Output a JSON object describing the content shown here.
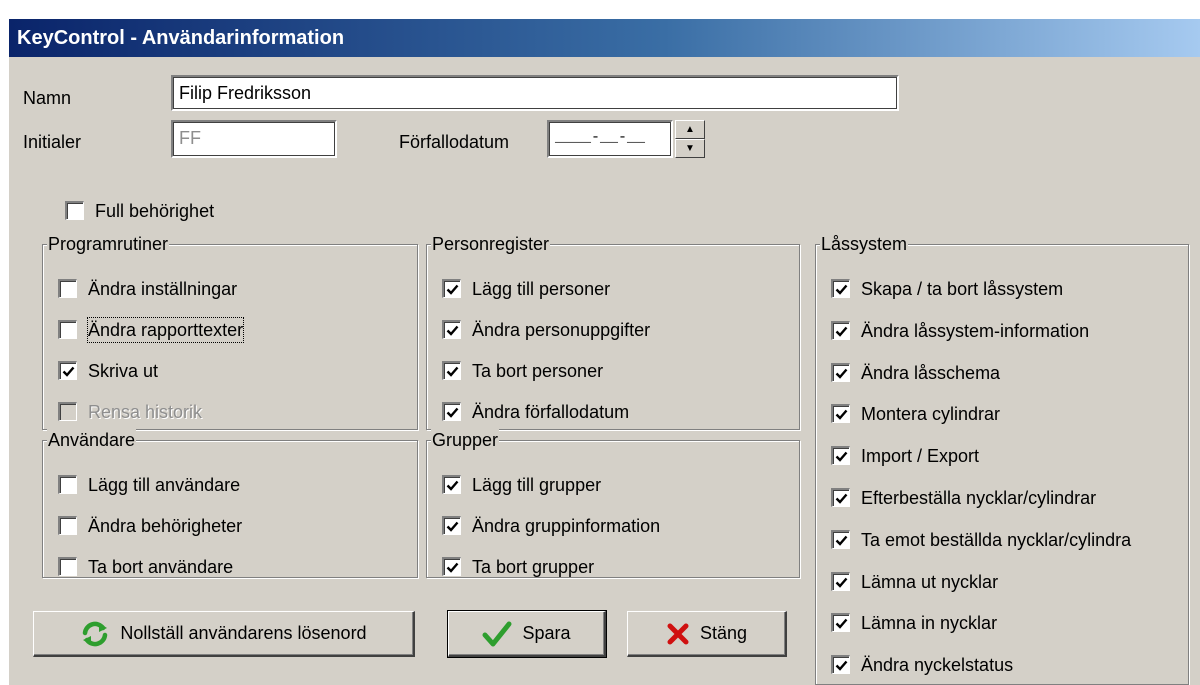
{
  "window": {
    "title": "KeyControl - Användarinformation"
  },
  "form": {
    "name_label": "Namn",
    "name_value": "Filip Fredriksson",
    "initials_label": "Initialer",
    "initials_value": "FF",
    "expiry_label": "Förfallodatum",
    "expiry_value": "____-__-__"
  },
  "full_access": {
    "label": "Full behörighet",
    "checked": false
  },
  "groups": {
    "programrutiner": {
      "title": "Programrutiner",
      "items": [
        {
          "label": "Ändra inställningar",
          "checked": false,
          "enabled": true
        },
        {
          "label": "Ändra rapporttexter",
          "checked": false,
          "enabled": true,
          "focused": true
        },
        {
          "label": "Skriva ut",
          "checked": true,
          "enabled": true
        },
        {
          "label": "Rensa historik",
          "checked": false,
          "enabled": false
        }
      ]
    },
    "anvandare": {
      "title": "Användare",
      "items": [
        {
          "label": "Lägg till användare",
          "checked": false,
          "enabled": true
        },
        {
          "label": "Ändra behörigheter",
          "checked": false,
          "enabled": true
        },
        {
          "label": "Ta bort användare",
          "checked": false,
          "enabled": true
        }
      ]
    },
    "personregister": {
      "title": "Personregister",
      "items": [
        {
          "label": "Lägg till personer",
          "checked": true,
          "enabled": true
        },
        {
          "label": "Ändra personuppgifter",
          "checked": true,
          "enabled": true
        },
        {
          "label": "Ta bort personer",
          "checked": true,
          "enabled": true
        },
        {
          "label": "Ändra förfallodatum",
          "checked": true,
          "enabled": true
        }
      ]
    },
    "grupper": {
      "title": "Grupper",
      "items": [
        {
          "label": "Lägg till grupper",
          "checked": true,
          "enabled": true
        },
        {
          "label": "Ändra gruppinformation",
          "checked": true,
          "enabled": true
        },
        {
          "label": "Ta bort grupper",
          "checked": true,
          "enabled": true
        }
      ]
    },
    "lassystem": {
      "title": "Låssystem",
      "items": [
        {
          "label": "Skapa / ta bort låssystem",
          "checked": true,
          "enabled": true
        },
        {
          "label": "Ändra låssystem-information",
          "checked": true,
          "enabled": true
        },
        {
          "label": "Ändra låsschema",
          "checked": true,
          "enabled": true
        },
        {
          "label": "Montera cylindrar",
          "checked": true,
          "enabled": true
        },
        {
          "label": "Import / Export",
          "checked": true,
          "enabled": true
        },
        {
          "label": "Efterbeställa nycklar/cylindrar",
          "checked": true,
          "enabled": true
        },
        {
          "label": "Ta emot beställda nycklar/cylindra",
          "checked": true,
          "enabled": true
        },
        {
          "label": "Lämna ut nycklar",
          "checked": true,
          "enabled": true
        },
        {
          "label": "Lämna in nycklar",
          "checked": true,
          "enabled": true
        },
        {
          "label": "Ändra nyckelstatus",
          "checked": true,
          "enabled": true
        }
      ]
    }
  },
  "buttons": {
    "reset_password": {
      "label": "Nollställ användarens lösenord",
      "icon": "refresh-icon"
    },
    "save": {
      "label": "Spara",
      "icon": "checkmark-icon"
    },
    "close": {
      "label": "Stäng",
      "icon": "x-icon"
    }
  },
  "colors": {
    "titlebar_start": "#0a246a",
    "titlebar_end": "#a6caf0",
    "window_bg": "#d4d0c8",
    "check_green": "#2e9e2e",
    "close_red": "#d01010"
  }
}
